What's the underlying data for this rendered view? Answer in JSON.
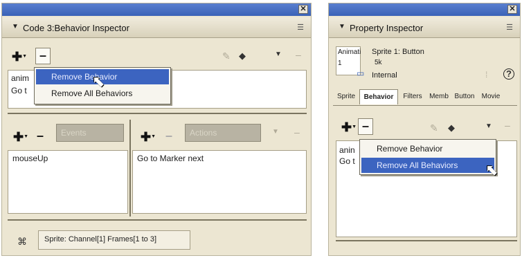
{
  "left": {
    "title": "Code 3:Behavior Inspector",
    "header_arrow_icon": "triangle-down-icon",
    "options_icon": "panel-options-icon",
    "behavior_list": [
      "anim",
      "Go t"
    ],
    "dropdown": {
      "items": [
        "Remove Behavior",
        "Remove All Behaviors"
      ],
      "selected_index": 0
    },
    "events_label": "Events",
    "actions_label": "Actions",
    "event_item": "mouseUp",
    "action_item": "Go to Marker next",
    "status": "Sprite:  Channel[1]  Frames[1 to 3]"
  },
  "right": {
    "title": "Property Inspector",
    "header_arrow_icon": "triangle-down-icon",
    "options_icon": "panel-options-icon",
    "thumb_label": "Animati",
    "thumb_number": "1",
    "sprite_title": "Sprite 1: Button",
    "size": "5k",
    "storage": "Internal",
    "help_glyph": "?",
    "tabs": [
      "Sprite",
      "Behavior",
      "Filters",
      "Memb",
      "Button",
      "Movie"
    ],
    "active_tab": "Behavior",
    "behavior_list": [
      "anin",
      "Go t"
    ],
    "dropdown": {
      "items": [
        "Remove Behavior",
        "Remove All Behaviors"
      ],
      "selected_index": 1
    }
  },
  "colors": {
    "title_bar": "#3a62b7",
    "panel_bg": "#ece6d2",
    "menu_highlight": "#3c64c0"
  }
}
